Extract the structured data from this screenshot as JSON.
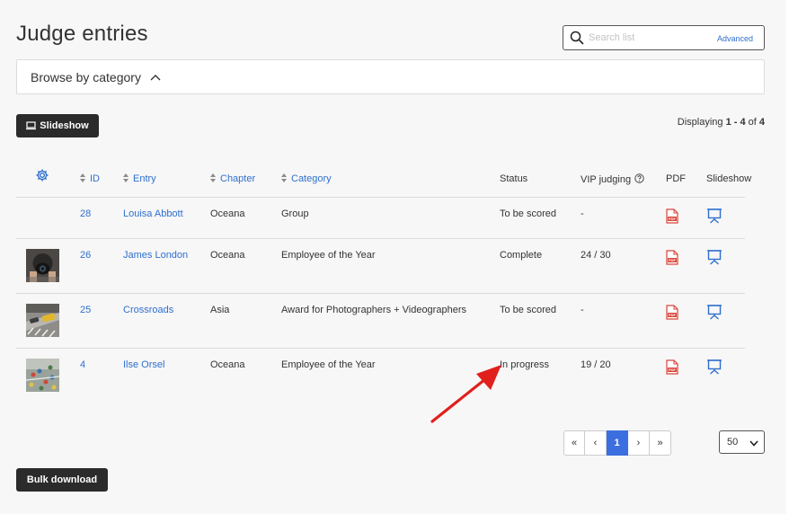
{
  "page_title": "Judge entries",
  "search": {
    "placeholder": "Search list",
    "advanced_label": "Advanced"
  },
  "browse": {
    "label": "Browse by category"
  },
  "toolbar": {
    "slideshow_label": "Slideshow",
    "bulk_download_label": "Bulk download"
  },
  "displaying": {
    "prefix": "Displaying ",
    "range": "1 - 4",
    "of": " of ",
    "total": "4"
  },
  "columns": {
    "id": "ID",
    "entry": "Entry",
    "chapter": "Chapter",
    "category": "Category",
    "status": "Status",
    "vip": "VIP judging",
    "pdf": "PDF",
    "slideshow": "Slideshow"
  },
  "rows": [
    {
      "id": "28",
      "entry": "Louisa Abbott",
      "chapter": "Oceana",
      "category": "Group",
      "status": "To be scored",
      "vip": "-",
      "has_thumb": false
    },
    {
      "id": "26",
      "entry": "James London",
      "chapter": "Oceana",
      "category": "Employee of the Year",
      "status": "Complete",
      "vip": "24 / 30",
      "has_thumb": true
    },
    {
      "id": "25",
      "entry": "Crossroads",
      "chapter": "Asia",
      "category": "Award for Photographers + Videographers",
      "status": "To be scored",
      "vip": "-",
      "has_thumb": true
    },
    {
      "id": "4",
      "entry": "Ilse Orsel",
      "chapter": "Oceana",
      "category": "Employee of the Year",
      "status": "In progress",
      "vip": "19 / 20",
      "has_thumb": true
    }
  ],
  "pagination": {
    "first": "«",
    "prev": "‹",
    "current": "1",
    "next": "›",
    "last": "»"
  },
  "per_page": {
    "selected": "50"
  },
  "icons": {
    "search": "search-icon",
    "chevron": "chevron-up-icon",
    "gear": "gear-icon",
    "pdf": "pdf-icon",
    "slideshow": "slideshow-icon",
    "help": "help-icon",
    "sort": "sort-icon"
  },
  "colors": {
    "link": "#2f6fcf",
    "pdf": "#d9443a",
    "active_page": "#3b6fe0",
    "button_dark": "#2b2b2b",
    "arrow": "#e0201c"
  }
}
